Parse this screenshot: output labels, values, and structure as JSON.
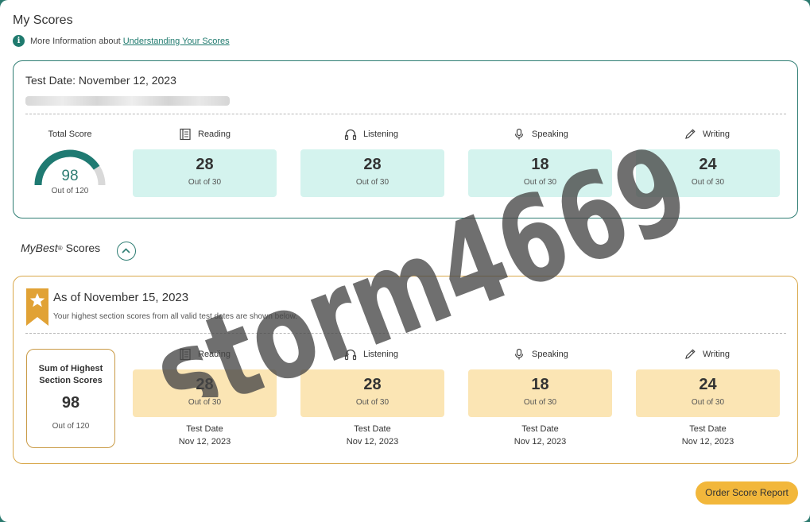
{
  "header": {
    "title": "My Scores",
    "info_text": "More Information about",
    "info_link": "Understanding Your Scores"
  },
  "test_card": {
    "test_date": "Test Date: November 12, 2023",
    "total_label": "Total Score",
    "total_value": "98",
    "total_out_of": "Out of 120",
    "total_fraction": 0.8167,
    "sections": [
      {
        "name": "Reading",
        "icon": "book-icon",
        "score": "28",
        "out_of": "Out of 30"
      },
      {
        "name": "Listening",
        "icon": "headphones-icon",
        "score": "28",
        "out_of": "Out of 30"
      },
      {
        "name": "Speaking",
        "icon": "microphone-icon",
        "score": "18",
        "out_of": "Out of 30"
      },
      {
        "name": "Writing",
        "icon": "pencil-icon",
        "score": "24",
        "out_of": "Out of 30"
      }
    ]
  },
  "mybest": {
    "label_italic": "MyBest",
    "label_reg": "®",
    "label_rest": "Scores",
    "as_of": "As of November 15, 2023",
    "subtitle": "Your highest section scores from all valid test dates are shown below.",
    "sum_title": "Sum of Highest Section Scores",
    "sum_value": "98",
    "sum_out_of": "Out of 120",
    "sections": [
      {
        "name": "Reading",
        "icon": "book-icon",
        "score": "28",
        "out_of": "Out of 30",
        "date_label": "Test Date",
        "date": "Nov 12, 2023"
      },
      {
        "name": "Listening",
        "icon": "headphones-icon",
        "score": "28",
        "out_of": "Out of 30",
        "date_label": "Test Date",
        "date": "Nov 12, 2023"
      },
      {
        "name": "Speaking",
        "icon": "microphone-icon",
        "score": "18",
        "out_of": "Out of 30",
        "date_label": "Test Date",
        "date": "Nov 12, 2023"
      },
      {
        "name": "Writing",
        "icon": "pencil-icon",
        "score": "24",
        "out_of": "Out of 30",
        "date_label": "Test Date",
        "date": "Nov 12, 2023"
      }
    ]
  },
  "actions": {
    "order_report": "Order Score Report"
  },
  "watermark": "storm4669",
  "colors": {
    "teal": "#2e7d73",
    "teal_light": "#d4f3ee",
    "gold": "#d9a84a",
    "gold_light": "#fbe5b4",
    "button": "#f2b73b"
  }
}
